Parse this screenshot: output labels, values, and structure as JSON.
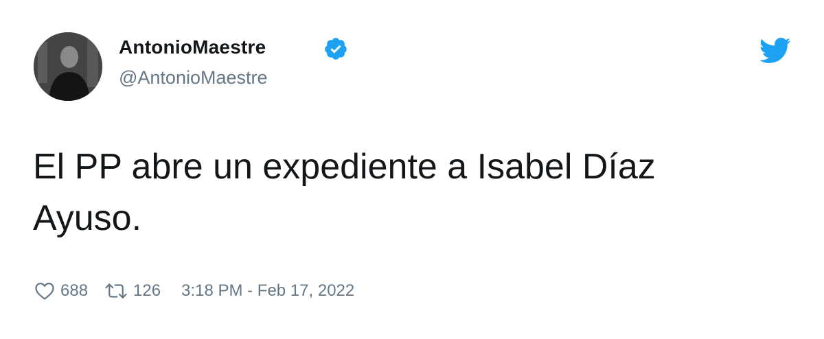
{
  "author": {
    "display_name": "AntonioMaestre",
    "handle": "@AntonioMaestre",
    "verified": true
  },
  "tweet": {
    "text": "El PP abre un expediente a Isabel Díaz Ayuso."
  },
  "metrics": {
    "likes": "688",
    "retweets": "126",
    "timestamp": "3:18 PM - Feb 17, 2022"
  },
  "icons": {
    "logo": "twitter-bird-icon",
    "verified": "verified-badge-icon",
    "like": "heart-icon",
    "retweet": "retweet-icon"
  },
  "colors": {
    "brand_blue": "#1da1f2",
    "text_primary": "#14171a",
    "text_secondary": "#657786"
  }
}
